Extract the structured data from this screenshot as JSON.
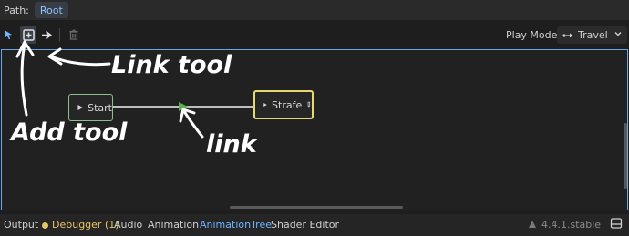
{
  "path": {
    "label": "Path:",
    "root": "Root"
  },
  "toolbar": {
    "select_icon": "pointer-icon",
    "add_icon": "add-node-icon",
    "link_icon": "connect-icon",
    "delete_icon": "trash-icon",
    "play_mode_label": "Play Mode:",
    "play_mode_value": "Travel",
    "play_mode_icon": "travel-icon"
  },
  "graph": {
    "nodes": [
      {
        "name": "Start",
        "state": "start",
        "color": "#8bbf8f"
      },
      {
        "name": "Strafe",
        "state": "selected",
        "color": "#e6d86e"
      }
    ],
    "link_color": "#59b34a"
  },
  "annotations": {
    "link_tool": "Link tool",
    "add_tool": "Add tool",
    "link": "link"
  },
  "bottom": {
    "tabs": [
      "Output",
      "Debugger (1)",
      "Audio",
      "Animation",
      "AnimationTree",
      "Shader Editor"
    ],
    "active_tab": "AnimationTree",
    "version": "4.4.1.stable"
  }
}
